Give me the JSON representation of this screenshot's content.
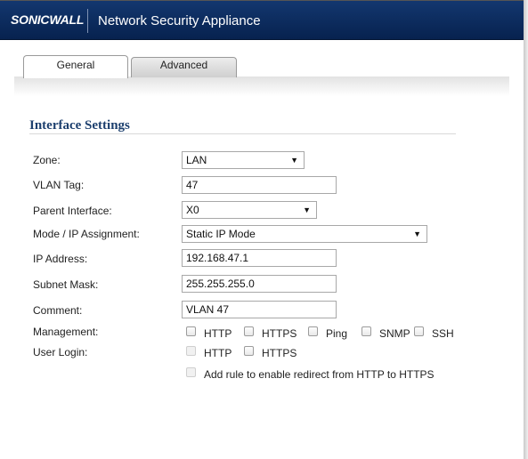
{
  "header": {
    "logo_text": "SONICWALL",
    "title": "Network Security Appliance"
  },
  "tabs": [
    {
      "label": "General",
      "selected": true
    },
    {
      "label": "Advanced",
      "selected": false
    }
  ],
  "section": {
    "title": "Interface Settings"
  },
  "form": {
    "zone": {
      "label": "Zone:",
      "value": "LAN"
    },
    "vlan_tag": {
      "label": "VLAN Tag:",
      "value": "47"
    },
    "parent_interface": {
      "label": "Parent Interface:",
      "value": "X0"
    },
    "mode": {
      "label": "Mode / IP Assignment:",
      "value": "Static IP Mode"
    },
    "ip_address": {
      "label": "IP Address:",
      "value": "192.168.47.1"
    },
    "subnet_mask": {
      "label": "Subnet Mask:",
      "value": "255.255.255.0"
    },
    "comment": {
      "label": "Comment:",
      "value": "VLAN 47"
    },
    "management": {
      "label": "Management:",
      "options": [
        {
          "label": "HTTP",
          "checked": false
        },
        {
          "label": "HTTPS",
          "checked": false
        },
        {
          "label": "Ping",
          "checked": false
        },
        {
          "label": "SNMP",
          "checked": false
        },
        {
          "label": "SSH",
          "checked": false
        }
      ]
    },
    "user_login": {
      "label": "User Login:",
      "options": [
        {
          "label": "HTTP",
          "checked": false,
          "enabled": false
        },
        {
          "label": "HTTPS",
          "checked": false,
          "enabled": true
        }
      ]
    },
    "redirect": {
      "label": "Add rule to enable redirect from HTTP to HTTPS",
      "checked": false,
      "enabled": false
    }
  },
  "icons": {
    "dropdown": "caret-down-icon"
  },
  "colors": {
    "header_bg": "#0a2a5e",
    "section_title": "#1c3f6e"
  }
}
